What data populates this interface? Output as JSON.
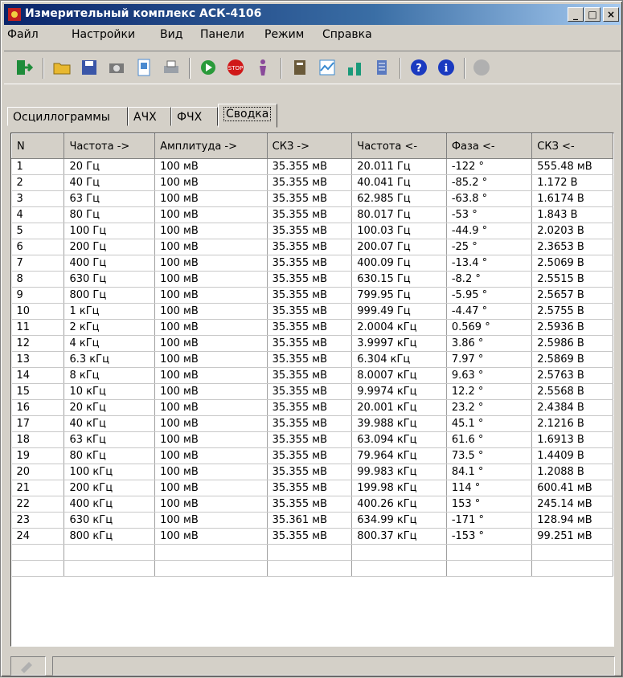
{
  "window": {
    "title": "Измерительный комплекс АСК-4106"
  },
  "title_buttons": {
    "minimize": "_",
    "maximize": "□",
    "close": "×"
  },
  "menu": [
    {
      "label": "Файл"
    },
    {
      "label": "Настройки"
    },
    {
      "label": "Вид"
    },
    {
      "label": "Панели"
    },
    {
      "label": "Режим"
    },
    {
      "label": "Справка"
    }
  ],
  "toolbar": [
    {
      "icon": "exit-icon",
      "color": "#1e8c3a"
    },
    {
      "icon": "open-folder-icon",
      "color": "#e8b830"
    },
    {
      "icon": "save-icon",
      "color": "#3a56a8"
    },
    {
      "icon": "camera-icon",
      "color": "#7a7a7a"
    },
    {
      "icon": "preview-icon",
      "color": "#4a8ad0"
    },
    {
      "icon": "print-icon",
      "color": "#9aa0a8"
    },
    {
      "icon": "run-icon",
      "color": "#2a9a3a"
    },
    {
      "icon": "stop-icon",
      "color": "#d01818"
    },
    {
      "icon": "wizard-icon",
      "color": "#8a4a9a"
    },
    {
      "icon": "book-icon",
      "color": "#6a5a3a"
    },
    {
      "icon": "chart-icon",
      "color": "#3a8ad0"
    },
    {
      "icon": "tools-icon",
      "color": "#1a9a7a"
    },
    {
      "icon": "settings-icon",
      "color": "#5a7ac0"
    },
    {
      "icon": "help-icon",
      "color": "#1a3ac0"
    },
    {
      "icon": "info-icon",
      "color": "#1a3ac0"
    },
    {
      "icon": "disabled-icon",
      "color": "#909090"
    }
  ],
  "tabs": [
    {
      "label": "Осциллограммы"
    },
    {
      "label": "АЧХ"
    },
    {
      "label": "ФЧХ"
    },
    {
      "label": "Сводка"
    }
  ],
  "table": {
    "columns": [
      "N",
      "Частота ->",
      "Амплитуда ->",
      "СКЗ ->",
      "Частота <-",
      "Фаза <-",
      "СКЗ <-"
    ],
    "rows": [
      [
        "1",
        "20 Гц",
        "100 мВ",
        "35.355 мВ",
        "20.011 Гц",
        "-122 °",
        "555.48 мВ"
      ],
      [
        "2",
        "40 Гц",
        "100 мВ",
        "35.355 мВ",
        "40.041 Гц",
        "-85.2 °",
        "1.172 В"
      ],
      [
        "3",
        "63 Гц",
        "100 мВ",
        "35.355 мВ",
        "62.985 Гц",
        "-63.8 °",
        "1.6174 В"
      ],
      [
        "4",
        "80 Гц",
        "100 мВ",
        "35.355 мВ",
        "80.017 Гц",
        "-53 °",
        "1.843 В"
      ],
      [
        "5",
        "100 Гц",
        "100 мВ",
        "35.355 мВ",
        "100.03 Гц",
        "-44.9 °",
        "2.0203 В"
      ],
      [
        "6",
        "200 Гц",
        "100 мВ",
        "35.355 мВ",
        "200.07 Гц",
        "-25 °",
        "2.3653 В"
      ],
      [
        "7",
        "400 Гц",
        "100 мВ",
        "35.355 мВ",
        "400.09 Гц",
        "-13.4 °",
        "2.5069 В"
      ],
      [
        "8",
        "630 Гц",
        "100 мВ",
        "35.355 мВ",
        "630.15 Гц",
        "-8.2 °",
        "2.5515 В"
      ],
      [
        "9",
        "800 Гц",
        "100 мВ",
        "35.355 мВ",
        "799.95 Гц",
        "-5.95 °",
        "2.5657 В"
      ],
      [
        "10",
        "1 кГц",
        "100 мВ",
        "35.355 мВ",
        "999.49 Гц",
        "-4.47 °",
        "2.5755 В"
      ],
      [
        "11",
        "2 кГц",
        "100 мВ",
        "35.355 мВ",
        "2.0004 кГц",
        "0.569 °",
        "2.5936 В"
      ],
      [
        "12",
        "4 кГц",
        "100 мВ",
        "35.355 мВ",
        "3.9997 кГц",
        "3.86 °",
        "2.5986 В"
      ],
      [
        "13",
        "6.3 кГц",
        "100 мВ",
        "35.355 мВ",
        "6.304 кГц",
        "7.97 °",
        "2.5869 В"
      ],
      [
        "14",
        "8 кГц",
        "100 мВ",
        "35.355 мВ",
        "8.0007 кГц",
        "9.63 °",
        "2.5763 В"
      ],
      [
        "15",
        "10 кГц",
        "100 мВ",
        "35.355 мВ",
        "9.9974 кГц",
        "12.2 °",
        "2.5568 В"
      ],
      [
        "16",
        "20 кГц",
        "100 мВ",
        "35.355 мВ",
        "20.001 кГц",
        "23.2 °",
        "2.4384 В"
      ],
      [
        "17",
        "40 кГц",
        "100 мВ",
        "35.355 мВ",
        "39.988 кГц",
        "45.1 °",
        "2.1216 В"
      ],
      [
        "18",
        "63 кГц",
        "100 мВ",
        "35.355 мВ",
        "63.094 кГц",
        "61.6 °",
        "1.6913 В"
      ],
      [
        "19",
        "80 кГц",
        "100 мВ",
        "35.355 мВ",
        "79.964 кГц",
        "73.5 °",
        "1.4409 В"
      ],
      [
        "20",
        "100 кГц",
        "100 мВ",
        "35.355 мВ",
        "99.983 кГц",
        "84.1 °",
        "1.2088 В"
      ],
      [
        "21",
        "200 кГц",
        "100 мВ",
        "35.355 мВ",
        "199.98 кГц",
        "114 °",
        "600.41 мВ"
      ],
      [
        "22",
        "400 кГц",
        "100 мВ",
        "35.355 мВ",
        "400.26 кГц",
        "153 °",
        "245.14 мВ"
      ],
      [
        "23",
        "630 кГц",
        "100 мВ",
        "35.361 мВ",
        "634.99 кГц",
        "-171 °",
        "128.94 мВ"
      ],
      [
        "24",
        "800 кГц",
        "100 мВ",
        "35.355 мВ",
        "800.37 кГц",
        "-153 °",
        "99.251 мВ"
      ]
    ]
  }
}
